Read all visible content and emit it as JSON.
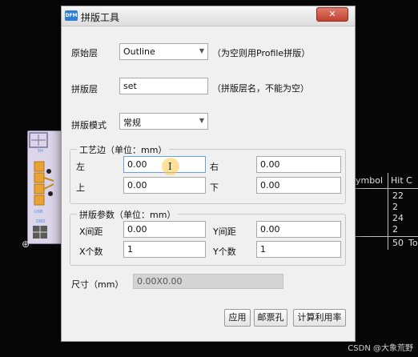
{
  "window": {
    "title": "拼版工具",
    "app_icon_text": "DFM",
    "close_glyph": "✕"
  },
  "form": {
    "original_layer": {
      "label": "原始层",
      "value": "Outline",
      "hint": "（为空则用Profile拼版）"
    },
    "panel_layer": {
      "label": "拼版层",
      "value": "set",
      "hint": "（拼版层名，不能为空）"
    },
    "panel_mode": {
      "label": "拼版模式",
      "value": "常规"
    }
  },
  "process_edge": {
    "title": "工艺边（单位：mm）",
    "left_label": "左",
    "left_value": "0.00",
    "right_label": "右",
    "right_value": "0.00",
    "top_label": "上",
    "top_value": "0.00",
    "bottom_label": "下",
    "bottom_value": "0.00"
  },
  "panel_params": {
    "title": "拼版参数（单位：mm）",
    "x_spacing_label": "X间距",
    "x_spacing_value": "0.00",
    "y_spacing_label": "Y间距",
    "y_spacing_value": "0.00",
    "x_count_label": "X个数",
    "x_count_value": "1",
    "y_count_label": "Y个数",
    "y_count_value": "1"
  },
  "size": {
    "label": "尺寸（mm）",
    "value": "0.00X0.00"
  },
  "buttons": {
    "apply": "应用",
    "stamp_hole": "邮票孔",
    "calc_utilization": "计算利用率"
  },
  "background_table": {
    "headers": [
      "ymbol",
      "Hit C"
    ],
    "hit_counts": [
      "22",
      "2",
      "24",
      "2"
    ],
    "total": "50",
    "total_suffix": "To"
  },
  "board": {
    "label_top": "5H",
    "label_mid": "USB",
    "label_bot": "GND"
  },
  "watermark": "CSDN @大象荒野"
}
